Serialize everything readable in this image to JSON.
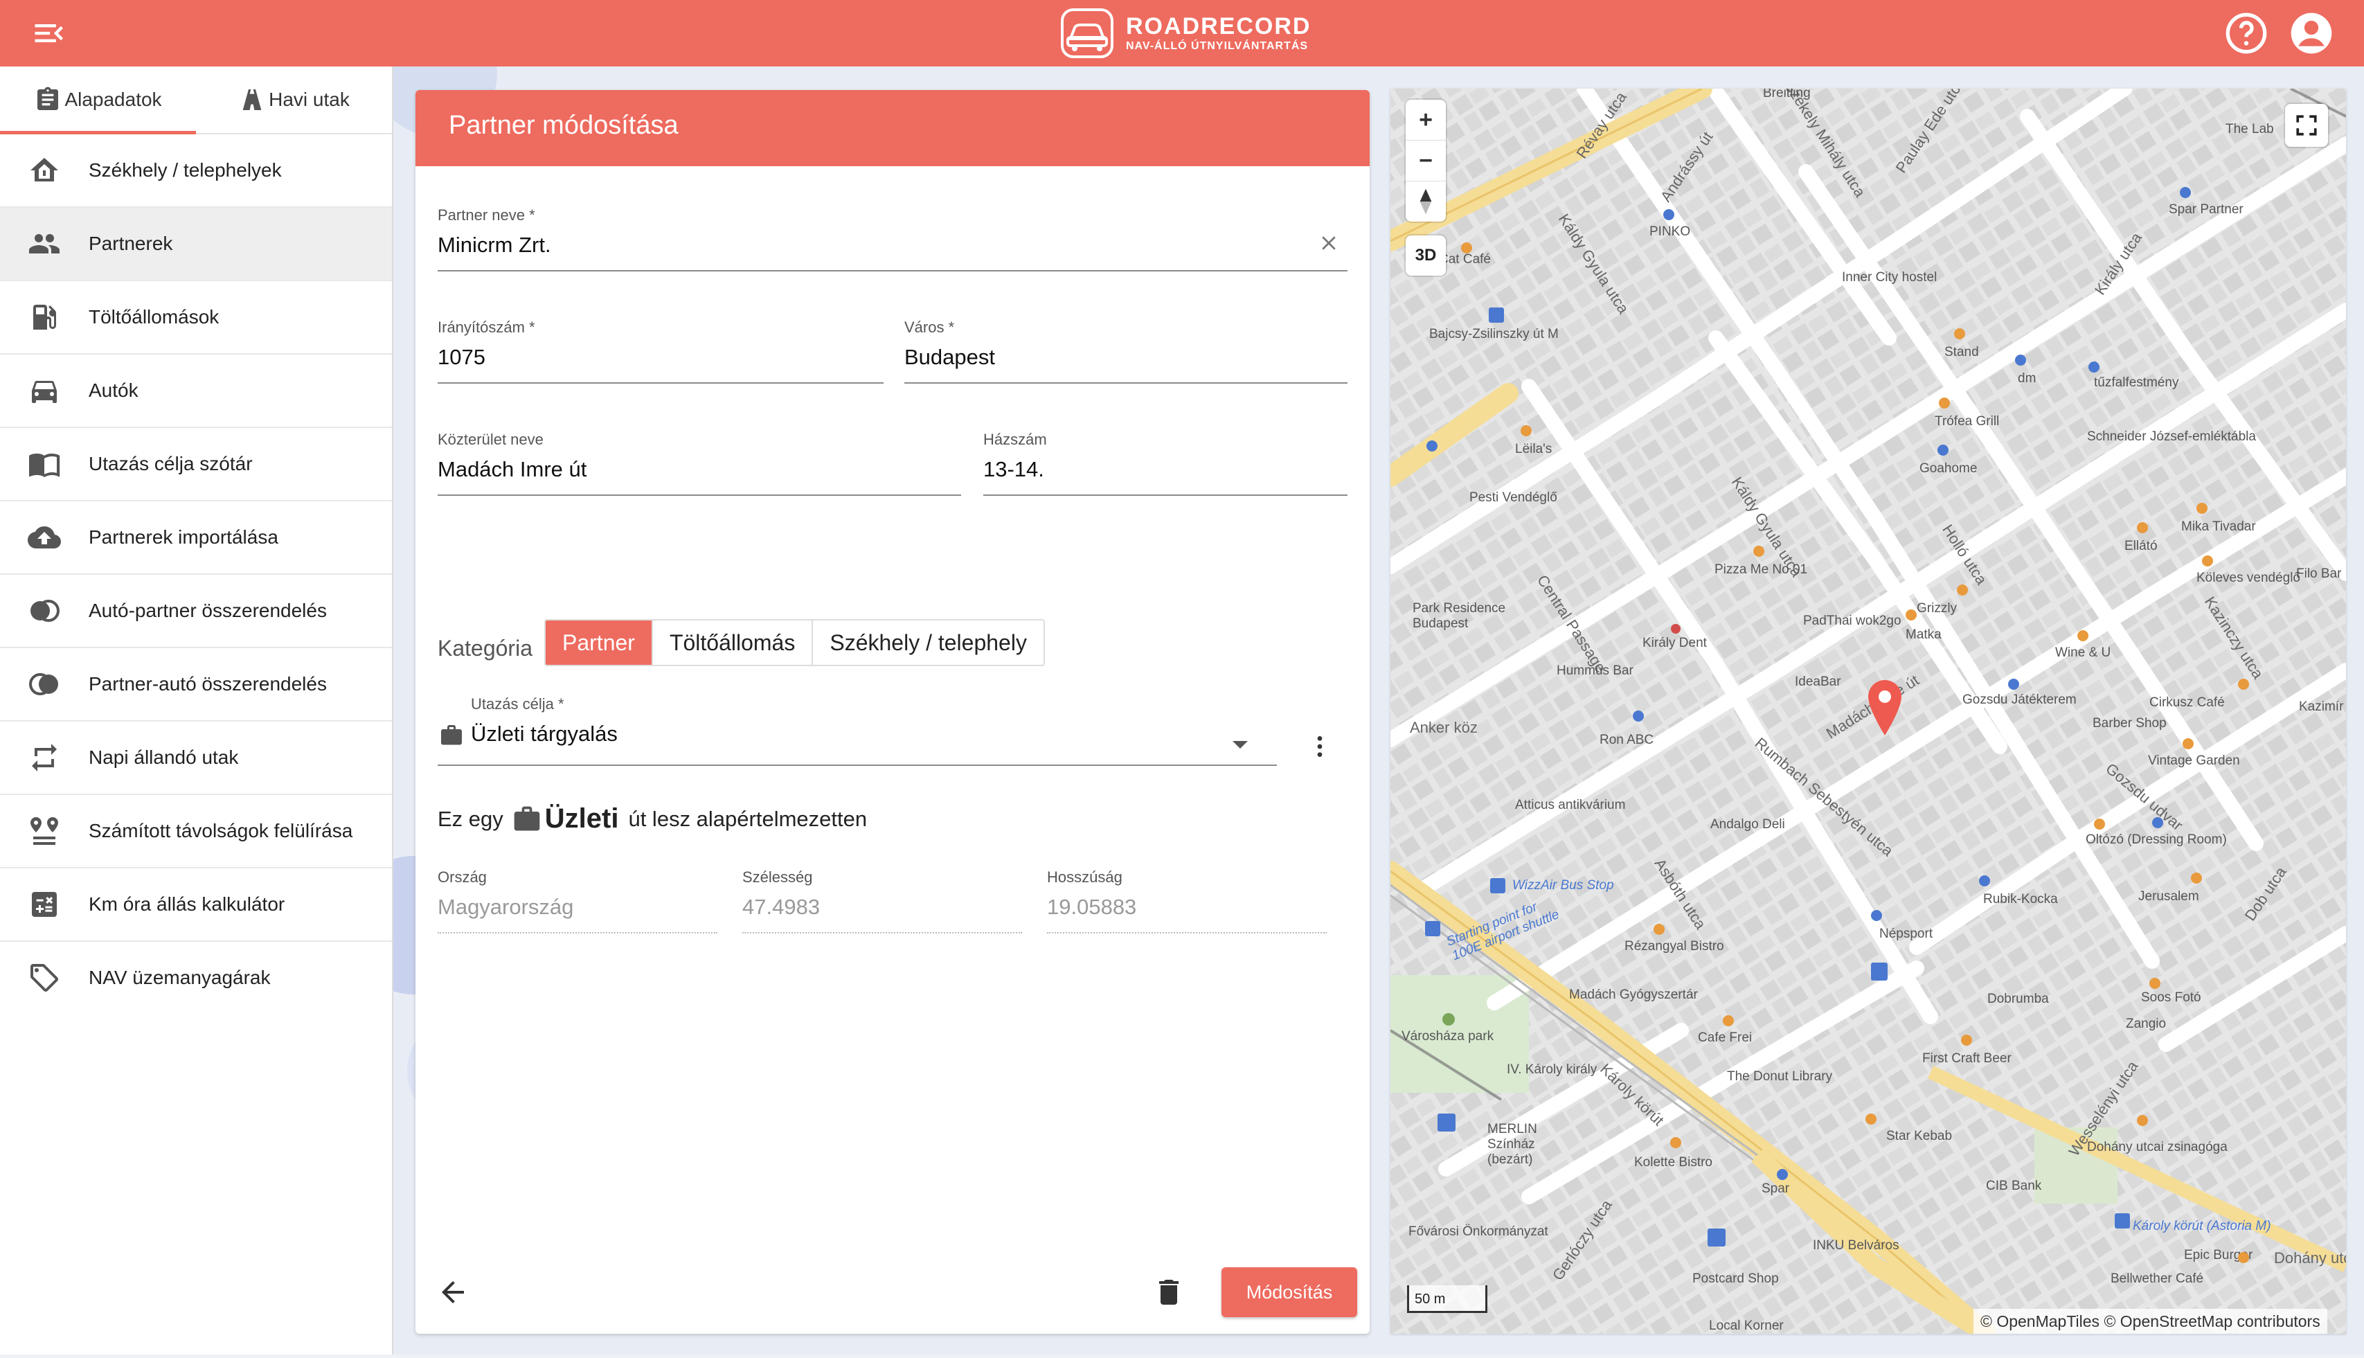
{
  "app": {
    "brand_name": "ROADRECORD",
    "brand_sub": "NAV-ÁLLÓ ÚTNYILVÁNTARTÁS",
    "accent_color": "#ee6b5f"
  },
  "sidebar": {
    "tabs": [
      {
        "label": "Alapadatok",
        "icon": "clipboard-icon",
        "active": true
      },
      {
        "label": "Havi utak",
        "icon": "road-icon",
        "active": false
      }
    ],
    "items": [
      {
        "label": "Székhely / telephelyek",
        "icon": "home-icon"
      },
      {
        "label": "Partnerek",
        "icon": "people-icon",
        "active": true
      },
      {
        "label": "Töltőállomások",
        "icon": "fuel-icon"
      },
      {
        "label": "Autók",
        "icon": "car-icon"
      },
      {
        "label": "Utazás célja szótár",
        "icon": "book-icon"
      },
      {
        "label": "Partnerek importálása",
        "icon": "cloud-upload-icon"
      },
      {
        "label": "Autó-partner összerendelés",
        "icon": "toggle-icon"
      },
      {
        "label": "Partner-autó összerendelés",
        "icon": "toggle-icon"
      },
      {
        "label": "Napi állandó utak",
        "icon": "repeat-icon"
      },
      {
        "label": "Számított távolságok felülírása",
        "icon": "pin-pair-icon"
      },
      {
        "label": "Km óra állás kalkulátor",
        "icon": "calculator-icon"
      },
      {
        "label": "NAV üzemanyagárak",
        "icon": "tag-icon"
      }
    ]
  },
  "form": {
    "title": "Partner módosítása",
    "partner_name": {
      "label": "Partner neve *",
      "value": "Minicrm Zrt."
    },
    "zip": {
      "label": "Irányítószám *",
      "value": "1075"
    },
    "city": {
      "label": "Város *",
      "value": "Budapest"
    },
    "street": {
      "label": "Közterület neve",
      "value": "Madách Imre út"
    },
    "house_number": {
      "label": "Házszám",
      "value": "13-14."
    },
    "category": {
      "label": "Kategória",
      "options": [
        "Partner",
        "Töltőállomás",
        "Székhely / telephely"
      ],
      "selected": "Partner"
    },
    "purpose": {
      "label": "Utazás célja *",
      "value": "Üzleti tárgyalás"
    },
    "default_text": {
      "prefix": "Ez egy",
      "emphasis": "Üzleti",
      "suffix": "út lesz alapértelmezetten"
    },
    "country": {
      "label": "Ország",
      "value": "Magyarország"
    },
    "latitude": {
      "label": "Szélesség",
      "value": "47.4983"
    },
    "longitude": {
      "label": "Hosszúság",
      "value": "19.05883"
    },
    "submit_label": "Módosítás"
  },
  "map": {
    "controls": {
      "zoom_in": "+",
      "zoom_out": "−",
      "mode_3d": "3D"
    },
    "scale": "50 m",
    "attribution": "© OpenMapTiles © OpenStreetMap contributors",
    "labels": [
      "Révay utca",
      "Andrássy út",
      "Székely Mihály utca",
      "Paulay Ede utca",
      "Király utca",
      "Káldy Gyula utca",
      "Holló utca",
      "Kazinczy utca",
      "Dob utca",
      "Rumbach Sebestyén utca",
      "Madách Imre út",
      "Károly körút",
      "Wesselényi utca",
      "Gerlóczy utca",
      "Asbóth utca",
      "Anker köz",
      "Gozsdu udvar",
      "Central Passage",
      "Cat Café",
      "Bajcsy-Zsilinszky út M",
      "PINKO",
      "Inner City hostel",
      "Spar Partner",
      "Stand",
      "dm",
      "tűzfalfestmény",
      "Trófea Grill",
      "Schneider József-emléktábla",
      "Lëila's",
      "Goahome",
      "Pesti Vendéglő",
      "Mika Tivadar",
      "Ellátó",
      "Köleves vendéglő",
      "Pizza Me No 01",
      "Park Residence Budapest",
      "PadThai wok2go",
      "Grizzly",
      "Király Dent",
      "Matka",
      "Wine & U",
      "Hummus Bar",
      "IdeaBar",
      "Gozsdu Játékterem",
      "Cirkusz Café",
      "Barber Shop",
      "Vintage Garden",
      "Ron ABC",
      "Atticus antikvárium",
      "Andalgo Deli",
      "Oltózó (Dressing Room)",
      "WizzAir Bus Stop",
      "Starting point for 100E airport shuttle",
      "Népsport",
      "Rubik-Kocka",
      "Jerusalem",
      "Rézangyal Bistro",
      "Madách Gyógyszertár",
      "Dobrumba",
      "Soos Fotó",
      "Városháza park",
      "Zangio",
      "Cafe Frei",
      "First Craft Beer",
      "IV. Károly király",
      "The Donut Library",
      "MERLIN Színház (bezárt)",
      "Star Kebab",
      "Kolette Bistro",
      "Dohány utcai zsinagóga",
      "Spar",
      "CIB Bank",
      "Károly körút (Astoria M)",
      "Fővárosi Önkormányzat",
      "INKU Belváros",
      "Epic Burger",
      "Dohány utca",
      "Postcard Shop",
      "Bellwether Café",
      "Local Korner",
      "Filo Bar",
      "Kazimír",
      "The Lab",
      "Breitling"
    ]
  }
}
